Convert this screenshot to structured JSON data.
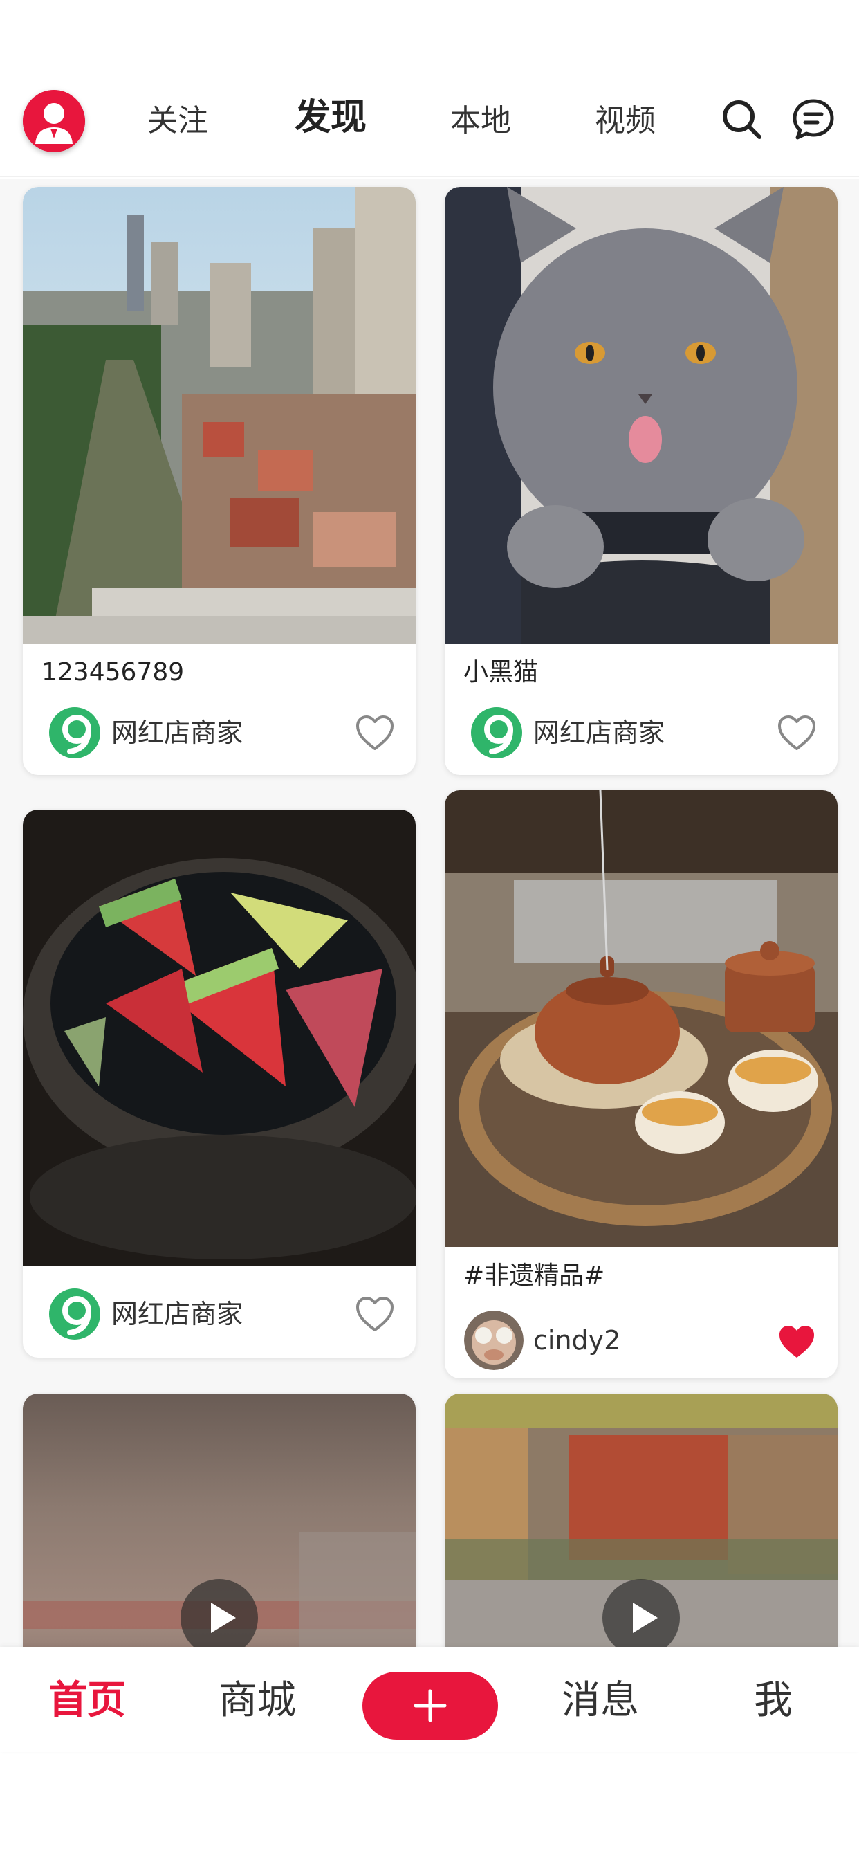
{
  "header": {
    "tabs": [
      {
        "label": "关注",
        "active": false
      },
      {
        "label": "发现",
        "active": true
      },
      {
        "label": "本地",
        "active": false
      },
      {
        "label": "视频",
        "active": false
      }
    ],
    "icons": [
      "user-avatar-icon",
      "search-icon",
      "message-icon"
    ]
  },
  "feed": {
    "cards": [
      {
        "title": "123456789",
        "author": "网红店商家",
        "liked": false,
        "image": "city-river"
      },
      {
        "title": "小黑猫",
        "author": "网红店商家",
        "liked": false,
        "image": "gray-cat"
      },
      {
        "title": "",
        "author": "网红店商家",
        "liked": false,
        "image": "watermelon-bowl"
      },
      {
        "title": "#非遗精品#",
        "author": "cindy2",
        "liked": true,
        "image": "teapot-set"
      },
      {
        "image": "blurred-video",
        "video": true
      },
      {
        "image": "blurred-video",
        "video": true
      }
    ]
  },
  "nav": {
    "items": [
      {
        "label": "首页",
        "active": true
      },
      {
        "label": "商城",
        "active": false
      },
      {
        "label": "消息",
        "active": false
      },
      {
        "label": "我",
        "active": false
      }
    ],
    "add_label": "+"
  },
  "colors": {
    "accent": "#e8163d",
    "like_active": "#e8163d",
    "merchant_green": "#2fb56a"
  }
}
